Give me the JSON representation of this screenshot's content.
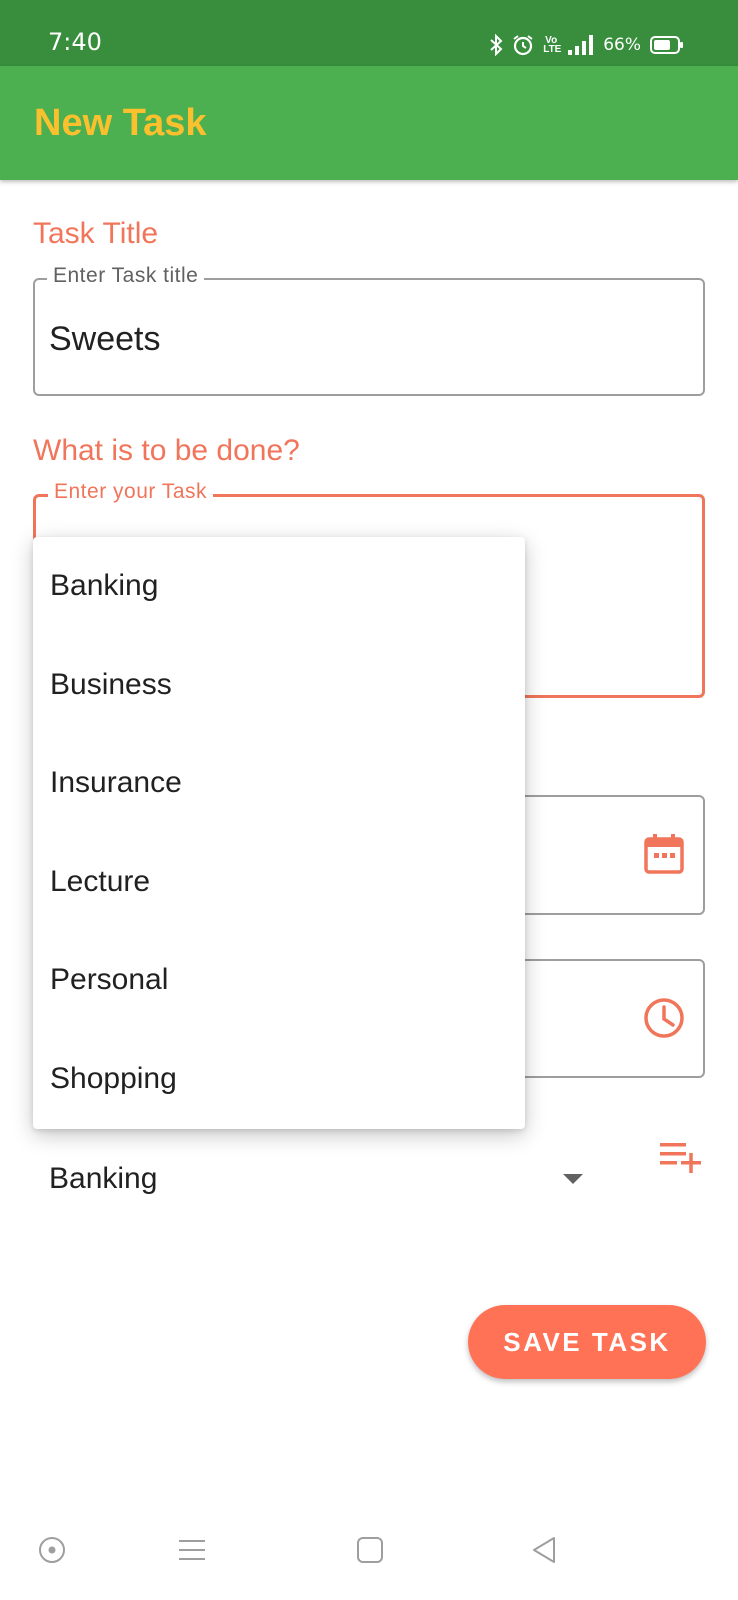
{
  "status_bar": {
    "time": "7:40",
    "volte_line1": "Vo",
    "volte_line2": "LTE",
    "battery": "66%"
  },
  "app_bar": {
    "title": "New Task"
  },
  "form": {
    "title_section": "Task Title",
    "title_field": {
      "label": "Enter Task title",
      "value": "Sweets"
    },
    "task_section": "What is to be done?",
    "task_field": {
      "label": "Enter your Task",
      "value": ""
    },
    "date_field": {
      "icon": "calendar-icon"
    },
    "time_field": {
      "icon": "clock-icon"
    },
    "category": {
      "selected": "Banking",
      "add_icon": "playlist-add-icon"
    }
  },
  "category_menu": {
    "options": [
      "Banking",
      "Business",
      "Insurance",
      "Lecture",
      "Personal",
      "Shopping"
    ]
  },
  "save_button": {
    "label": "SAVE TASK"
  },
  "colors": {
    "status_bar": "#388e3c",
    "app_bar": "#4caf50",
    "title": "#fbc02d",
    "accent": "#f0755a",
    "button": "#ff7256"
  },
  "nav_bar": {
    "icons": [
      "assistant-icon",
      "recents-icon",
      "home-icon",
      "back-icon"
    ]
  }
}
